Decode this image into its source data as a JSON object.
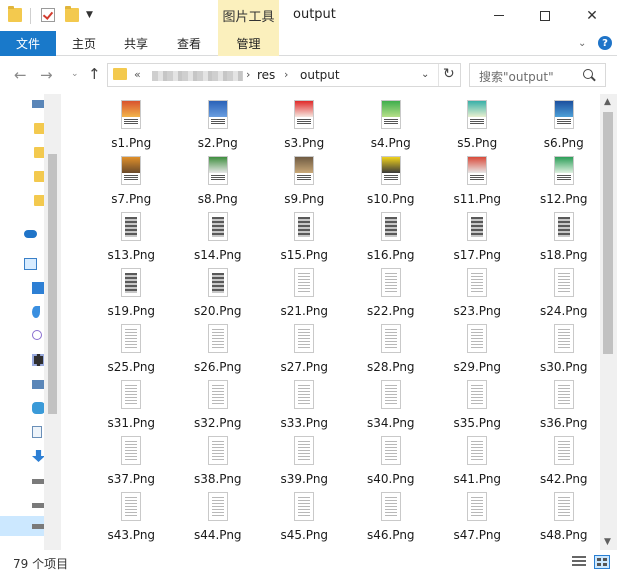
{
  "window": {
    "context_tab_group": "图片工具",
    "title": "output",
    "minimize": "minimize",
    "maximize": "maximize",
    "close": "✕"
  },
  "ribbon": {
    "tabs": [
      {
        "label": "文件"
      },
      {
        "label": "主页"
      },
      {
        "label": "共享"
      },
      {
        "label": "查看"
      },
      {
        "label": "管理"
      }
    ],
    "help_label": "?"
  },
  "address": {
    "prefix": "«",
    "segments": [
      "res",
      "output"
    ],
    "separator": "›"
  },
  "search": {
    "placeholder": "搜索\"output\""
  },
  "items": [
    {
      "name": "s1.Png",
      "thumb": "color",
      "colors": [
        "#d8532e",
        "#f2b44a"
      ]
    },
    {
      "name": "s2.Png",
      "thumb": "color",
      "colors": [
        "#2a62b8",
        "#6a9ee0"
      ]
    },
    {
      "name": "s3.Png",
      "thumb": "color",
      "colors": [
        "#e02a2a",
        "#f6e7e0"
      ]
    },
    {
      "name": "s4.Png",
      "thumb": "color",
      "colors": [
        "#3fae4c",
        "#b7e08a"
      ]
    },
    {
      "name": "s5.Png",
      "thumb": "color",
      "colors": [
        "#39b0a8",
        "#e9f0d0"
      ]
    },
    {
      "name": "s6.Png",
      "thumb": "color",
      "colors": [
        "#1c4f9e",
        "#4ea0d8"
      ]
    },
    {
      "name": "s7.Png",
      "thumb": "color",
      "colors": [
        "#e0902a",
        "#6a4a2a"
      ]
    },
    {
      "name": "s8.Png",
      "thumb": "color",
      "colors": [
        "#3f8e3f",
        "#e8e8e8"
      ]
    },
    {
      "name": "s9.Png",
      "thumb": "color",
      "colors": [
        "#6f5b43",
        "#c9a878"
      ]
    },
    {
      "name": "s10.Png",
      "thumb": "color",
      "colors": [
        "#f1d31c",
        "#3a3a3a"
      ]
    },
    {
      "name": "s11.Png",
      "thumb": "color",
      "colors": [
        "#d84a3a",
        "#e8e8e8"
      ]
    },
    {
      "name": "s12.Png",
      "thumb": "color",
      "colors": [
        "#2c9e58",
        "#dff0e0"
      ]
    },
    {
      "name": "s13.Png",
      "thumb": "dark"
    },
    {
      "name": "s14.Png",
      "thumb": "dark"
    },
    {
      "name": "s15.Png",
      "thumb": "dark"
    },
    {
      "name": "s16.Png",
      "thumb": "dark"
    },
    {
      "name": "s17.Png",
      "thumb": "dark"
    },
    {
      "name": "s18.Png",
      "thumb": "dark"
    },
    {
      "name": "s19.Png",
      "thumb": "dark"
    },
    {
      "name": "s20.Png",
      "thumb": "dark"
    },
    {
      "name": "s21.Png",
      "thumb": "text"
    },
    {
      "name": "s22.Png",
      "thumb": "text"
    },
    {
      "name": "s23.Png",
      "thumb": "text"
    },
    {
      "name": "s24.Png",
      "thumb": "text"
    },
    {
      "name": "s25.Png",
      "thumb": "text"
    },
    {
      "name": "s26.Png",
      "thumb": "text"
    },
    {
      "name": "s27.Png",
      "thumb": "text"
    },
    {
      "name": "s28.Png",
      "thumb": "text"
    },
    {
      "name": "s29.Png",
      "thumb": "text"
    },
    {
      "name": "s30.Png",
      "thumb": "text"
    },
    {
      "name": "s31.Png",
      "thumb": "text"
    },
    {
      "name": "s32.Png",
      "thumb": "text"
    },
    {
      "name": "s33.Png",
      "thumb": "text"
    },
    {
      "name": "s34.Png",
      "thumb": "text"
    },
    {
      "name": "s35.Png",
      "thumb": "text"
    },
    {
      "name": "s36.Png",
      "thumb": "text"
    },
    {
      "name": "s37.Png",
      "thumb": "text"
    },
    {
      "name": "s38.Png",
      "thumb": "text"
    },
    {
      "name": "s39.Png",
      "thumb": "text"
    },
    {
      "name": "s40.Png",
      "thumb": "text"
    },
    {
      "name": "s41.Png",
      "thumb": "text"
    },
    {
      "name": "s42.Png",
      "thumb": "text"
    },
    {
      "name": "s43.Png",
      "thumb": "text"
    },
    {
      "name": "s44.Png",
      "thumb": "text"
    },
    {
      "name": "s45.Png",
      "thumb": "text"
    },
    {
      "name": "s46.Png",
      "thumb": "text"
    },
    {
      "name": "s47.Png",
      "thumb": "text"
    },
    {
      "name": "s48.Png",
      "thumb": "text"
    }
  ],
  "status": {
    "count_text": "79 个项目"
  },
  "theme": {
    "accent": "#1979ca",
    "context_tab": "#fbf0bd",
    "selection": "#cce8ff"
  }
}
